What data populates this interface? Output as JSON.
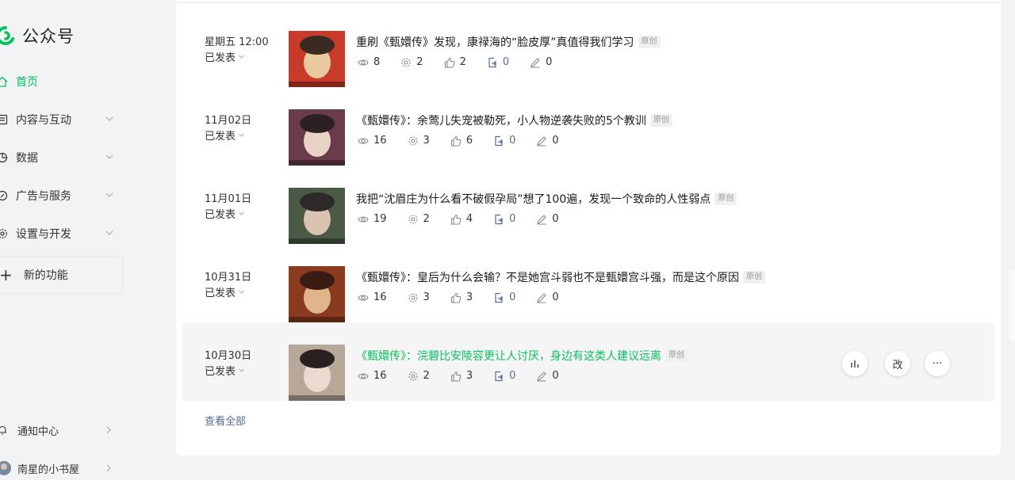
{
  "app": {
    "name": "公众号"
  },
  "sidebar": {
    "items": [
      {
        "label": "首页",
        "icon": "home-icon",
        "active": true
      },
      {
        "label": "内容与互动",
        "icon": "content-icon"
      },
      {
        "label": "数据",
        "icon": "data-icon"
      },
      {
        "label": "广告与服务",
        "icon": "ads-icon"
      },
      {
        "label": "设置与开发",
        "icon": "settings-icon"
      }
    ],
    "new_feature": "新的功能",
    "notification": "通知中心",
    "account": "南星的小书屋"
  },
  "articles": [
    {
      "date": "星期五 12:00",
      "status": "已发表",
      "title": "重刷《甄嬛传》发现，康禄海的“脸皮厚”真值得我们学习",
      "tag": "原创",
      "views": "8",
      "shares": "2",
      "likes": "2",
      "forwards": "0",
      "comments": "0",
      "thumb_colors": [
        "#c83a2a",
        "#e8c9a0",
        "#3a2a22"
      ]
    },
    {
      "date": "11月02日",
      "status": "已发表",
      "title": "《甄嬛传》：余莺儿失宠被勒死，小人物逆袭失败的5个教训",
      "tag": "原创",
      "views": "16",
      "shares": "3",
      "likes": "6",
      "forwards": "0",
      "comments": "0",
      "thumb_colors": [
        "#6a3b4a",
        "#e9d3c4",
        "#2c2024"
      ]
    },
    {
      "date": "11月01日",
      "status": "已发表",
      "title": "我把“沈眉庄为什么看不破假孕局”想了100遍，发现一个致命的人性弱点",
      "tag": "原创",
      "views": "19",
      "shares": "2",
      "likes": "4",
      "forwards": "0",
      "comments": "0",
      "thumb_colors": [
        "#4b5a44",
        "#d9c2b0",
        "#2e2a2a"
      ]
    },
    {
      "date": "10月31日",
      "status": "已发表",
      "title": "《甄嬛传》：皇后为什么会输？不是她宫斗弱也不是甄嬛宫斗强，而是这个原因",
      "tag": "原创",
      "views": "16",
      "shares": "3",
      "likes": "3",
      "forwards": "0",
      "comments": "0",
      "thumb_colors": [
        "#8a3a1e",
        "#e0b58a",
        "#3a1c14"
      ]
    },
    {
      "date": "10月30日",
      "status": "已发表",
      "title": "《甄嬛传》：浣碧比安陵容更让人讨厌，身边有这类人建议远离",
      "tag": "原创",
      "views": "16",
      "shares": "2",
      "likes": "3",
      "forwards": "0",
      "comments": "0",
      "thumb_colors": [
        "#b8a89a",
        "#ecd9cf",
        "#2a2020"
      ],
      "highlighted": true
    }
  ],
  "row_actions": {
    "stats_icon": "bar-chart-icon",
    "edit_label": "改",
    "more_label": "···"
  },
  "view_all": "查看全部",
  "colors": {
    "accent": "#07c160",
    "link": "#576b95"
  }
}
